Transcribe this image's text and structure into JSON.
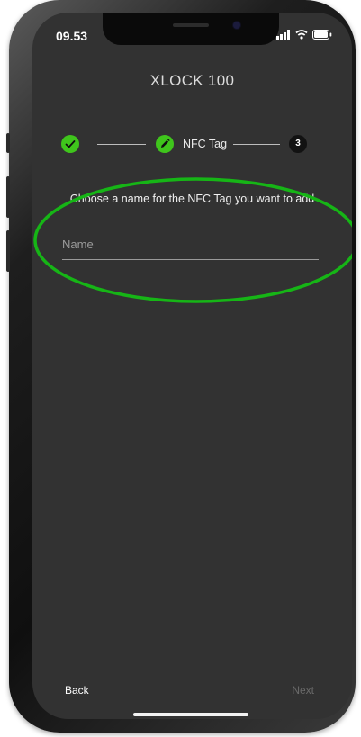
{
  "status_bar": {
    "time": "09.53",
    "icons": [
      "signal-icon",
      "wifi-icon",
      "battery-icon"
    ]
  },
  "header": {
    "title": "XLOCK 100"
  },
  "stepper": {
    "step1": {
      "state": "completed",
      "icon": "check-icon"
    },
    "step2": {
      "state": "active",
      "icon": "pencil-icon",
      "label": "NFC Tag"
    },
    "step3": {
      "state": "upcoming",
      "label": "3"
    }
  },
  "form": {
    "prompt": "Choose a name for the NFC Tag you want to add",
    "name_placeholder": "Name",
    "name_value": ""
  },
  "footer": {
    "back_label": "Back",
    "next_label": "Next"
  },
  "colors": {
    "accent": "#3fc51c",
    "background": "#323232",
    "highlight_ring": "#16b516"
  }
}
